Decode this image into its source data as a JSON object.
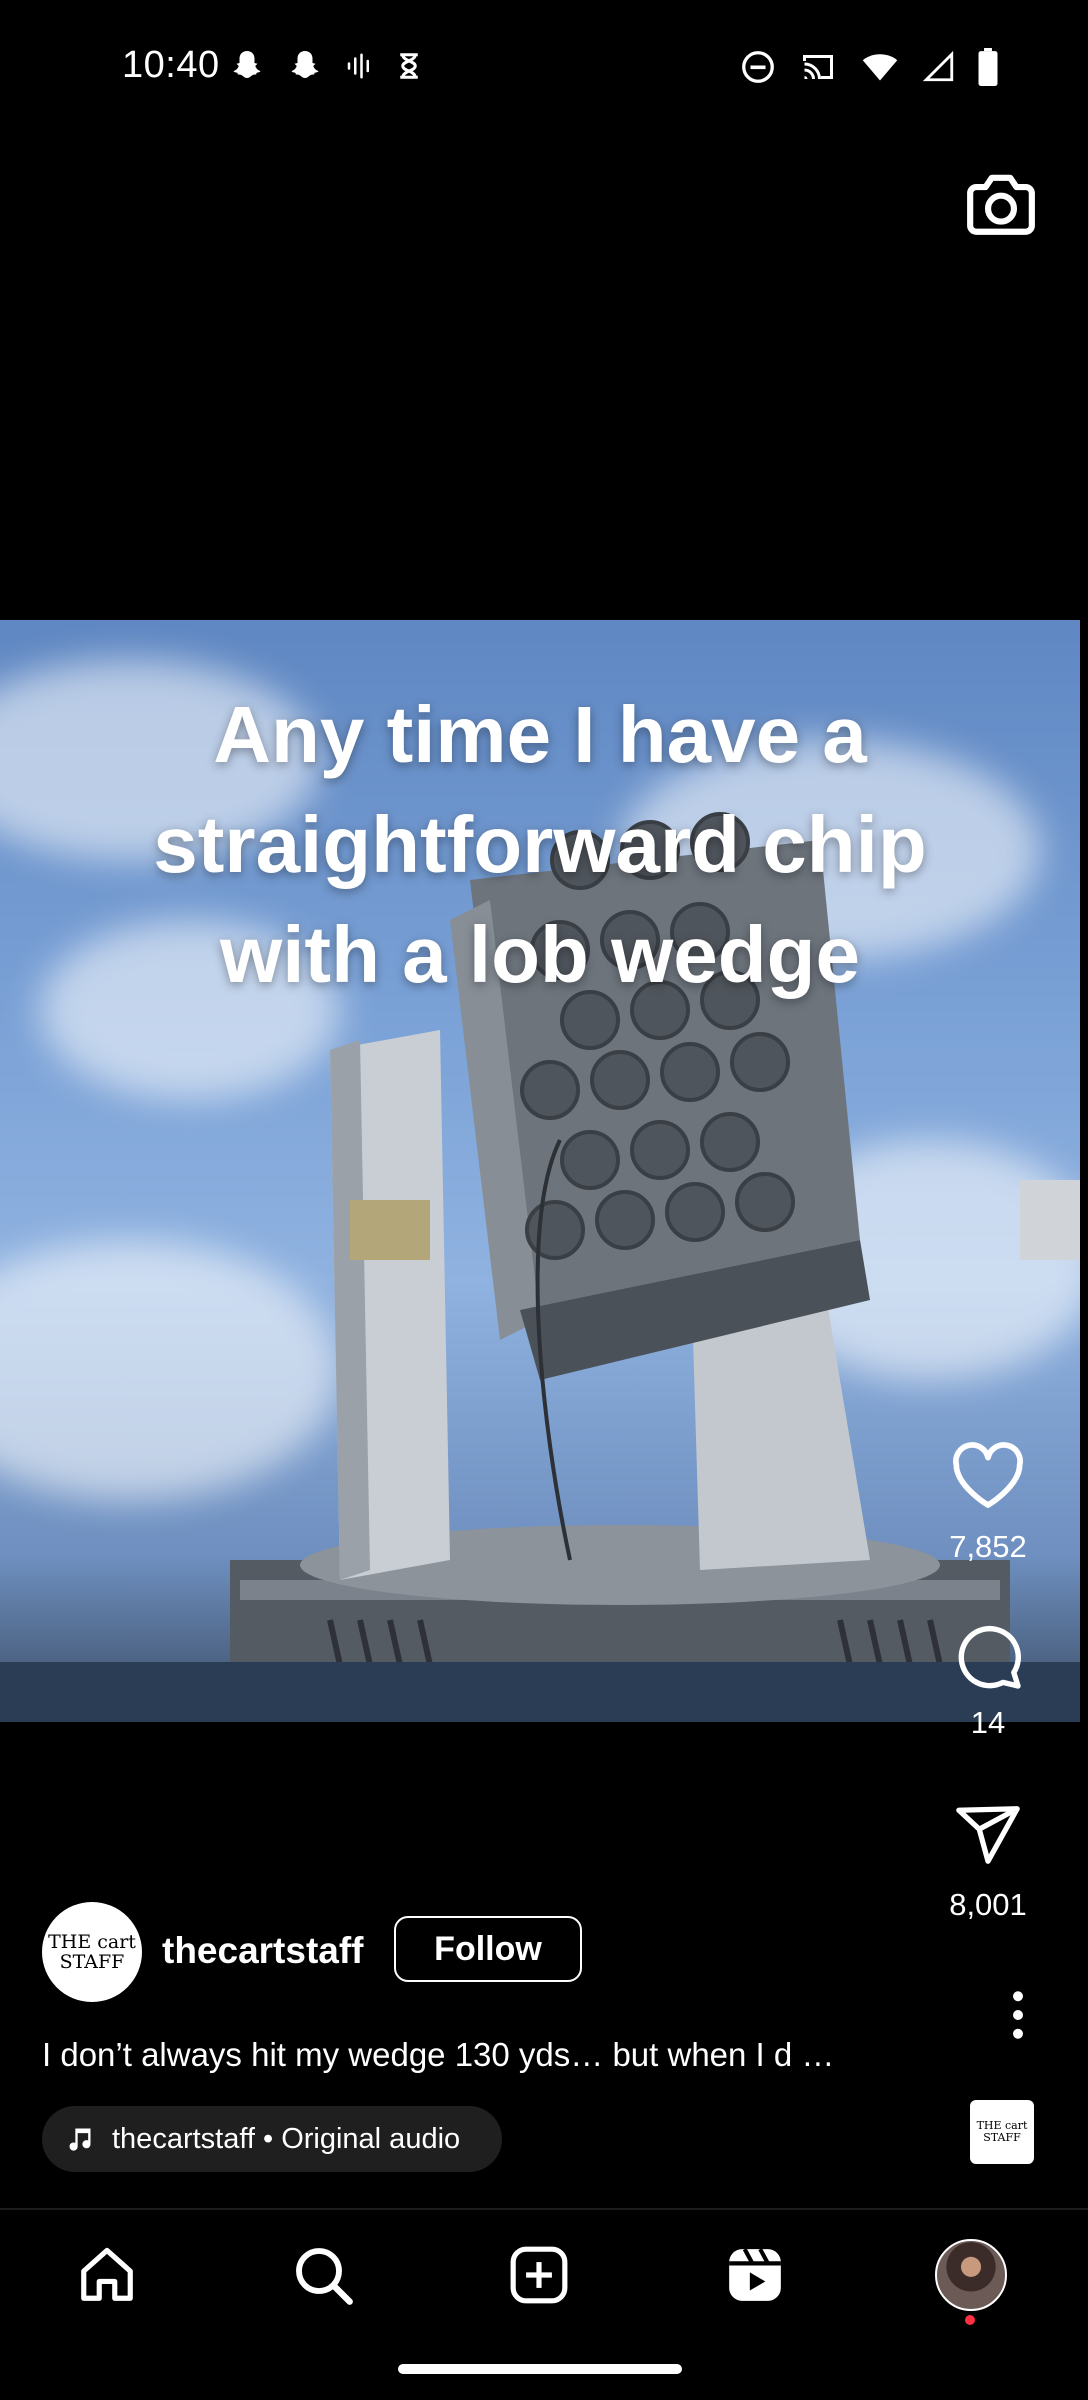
{
  "status_bar": {
    "time": "10:40",
    "left_icons": [
      "snapchat-icon",
      "snapchat-icon",
      "voice-recorder-icon",
      "hourglass-icon"
    ],
    "right_icons": [
      "do-not-disturb-icon",
      "cast-icon",
      "wifi-icon",
      "cell-signal-icon",
      "battery-icon"
    ]
  },
  "reel": {
    "caption_lines": [
      "Any time I have a",
      "straightforward chip",
      "with a lob wedge"
    ]
  },
  "actions": {
    "likes": "7,852",
    "comments": "14",
    "shares": "8,001"
  },
  "author": {
    "avatar_text": "THE cart STAFF",
    "username": "thecartstaff",
    "follow_label": "Follow"
  },
  "description": "I don’t always hit my wedge 130 yds… but when I d …",
  "audio": {
    "label": "thecartstaff • Original audio",
    "thumb_text": "THE cart STAFF"
  },
  "bottom_nav": [
    "home-icon",
    "search-icon",
    "create-icon",
    "reels-icon",
    "profile-avatar"
  ],
  "colors": {
    "background": "#000000",
    "text": "#ffffff",
    "notification_dot": "#ff3040",
    "audio_pill": "#1f1f1f"
  }
}
